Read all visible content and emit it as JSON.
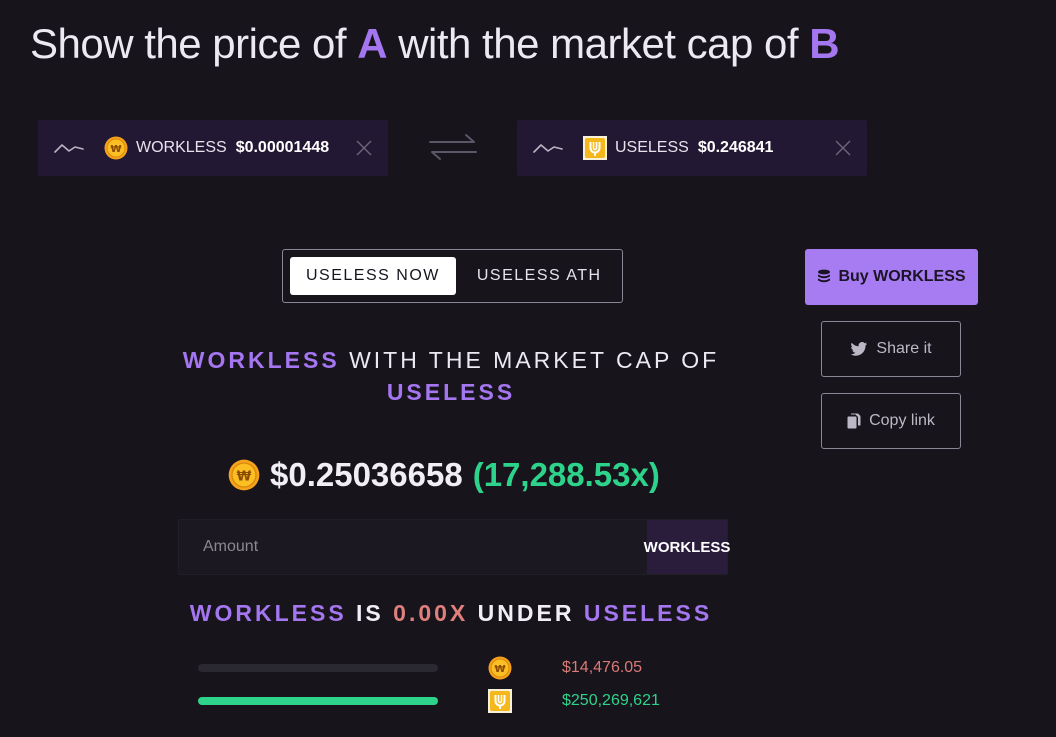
{
  "title": {
    "prefix": "Show the price of ",
    "a": "A",
    "middle": " with the market cap of ",
    "b": "B"
  },
  "token_a": {
    "symbol": "WORKLESS",
    "price": "$0.00001448",
    "icon": "workless-coin-icon"
  },
  "token_b": {
    "symbol": "USELESS",
    "price": "$0.246841",
    "icon": "useless-coin-icon"
  },
  "toggle": {
    "options": [
      "USELESS NOW",
      "USELESS ATH"
    ],
    "active": "USELESS NOW"
  },
  "actions": {
    "buy_label": "Buy WORKLESS",
    "share_label": "Share it",
    "copy_label": "Copy link"
  },
  "headline": {
    "token_a": "WORKLESS",
    "middle": "WITH THE MARKET CAP OF",
    "token_b": "USELESS"
  },
  "result": {
    "price": "$0.25036658",
    "multiplier": "(17,288.53x)"
  },
  "amount": {
    "placeholder": "Amount",
    "unit": "WORKLESS",
    "value": ""
  },
  "compare": {
    "token_a": "WORKLESS",
    "is": "IS",
    "factor": "0.00X",
    "under": "UNDER",
    "token_b": "USELESS"
  },
  "market_caps": [
    {
      "token": "WORKLESS",
      "value": "$14,476.05",
      "fill": 6e-05,
      "color": "#d97a76",
      "icon": "workless-coin-icon"
    },
    {
      "token": "USELESS",
      "value": "$250,269,621",
      "fill": 1.0,
      "color": "#2ed38b",
      "icon": "useless-coin-icon"
    }
  ],
  "colors": {
    "accent": "#a476f0",
    "positive": "#2ed38b",
    "negative": "#e07f7b",
    "background": "#18141c"
  }
}
